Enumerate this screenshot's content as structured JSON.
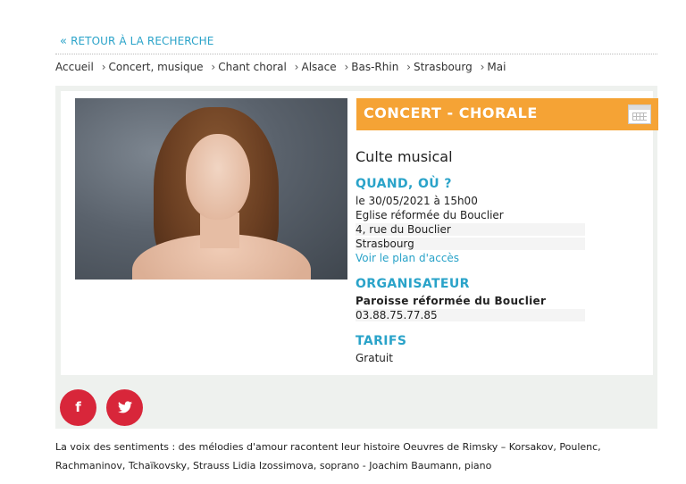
{
  "back_link": {
    "chevron": "«",
    "label": "RETOUR À LA RECHERCHE"
  },
  "breadcrumb": {
    "separator": "›",
    "items": [
      "Accueil",
      "Concert, musique",
      "Chant choral",
      "Alsace",
      "Bas-Rhin",
      "Strasbourg",
      "Mai"
    ]
  },
  "event": {
    "category": "CONCERT - CHORALE",
    "title": "Culte musical",
    "photo_icon": "photo-woman-portrait",
    "calendar_icon": "calendar-icon",
    "when_where": {
      "heading": "QUAND, OÙ ?",
      "date": "le 30/05/2021 à 15h00",
      "venue": "Eglise réformée du Bouclier",
      "address": "4, rue du Bouclier",
      "city": "Strasbourg",
      "map_link": "Voir le plan d'accès"
    },
    "organizer": {
      "heading": "ORGANISATEUR",
      "name": "Paroisse réformée du Bouclier",
      "phone": "03.88.75.77.85"
    },
    "prices": {
      "heading": "TARIFS",
      "value": "Gratuit"
    }
  },
  "social": {
    "facebook": "f",
    "twitter": "🐦"
  },
  "description": "La voix des sentiments : des mélodies d'amour racontent leur histoire Oeuvres de Rimsky – Korsakov, Poulenc, Rachmaninov, Tchaïkovsky, Strauss Lidia Izossimova, soprano - Joachim Baumann, piano",
  "colors": {
    "accent_blue": "#2aa3c9",
    "category_orange": "#f5a335",
    "social_red": "#d8263a",
    "panel_bg": "#eef1ee"
  }
}
